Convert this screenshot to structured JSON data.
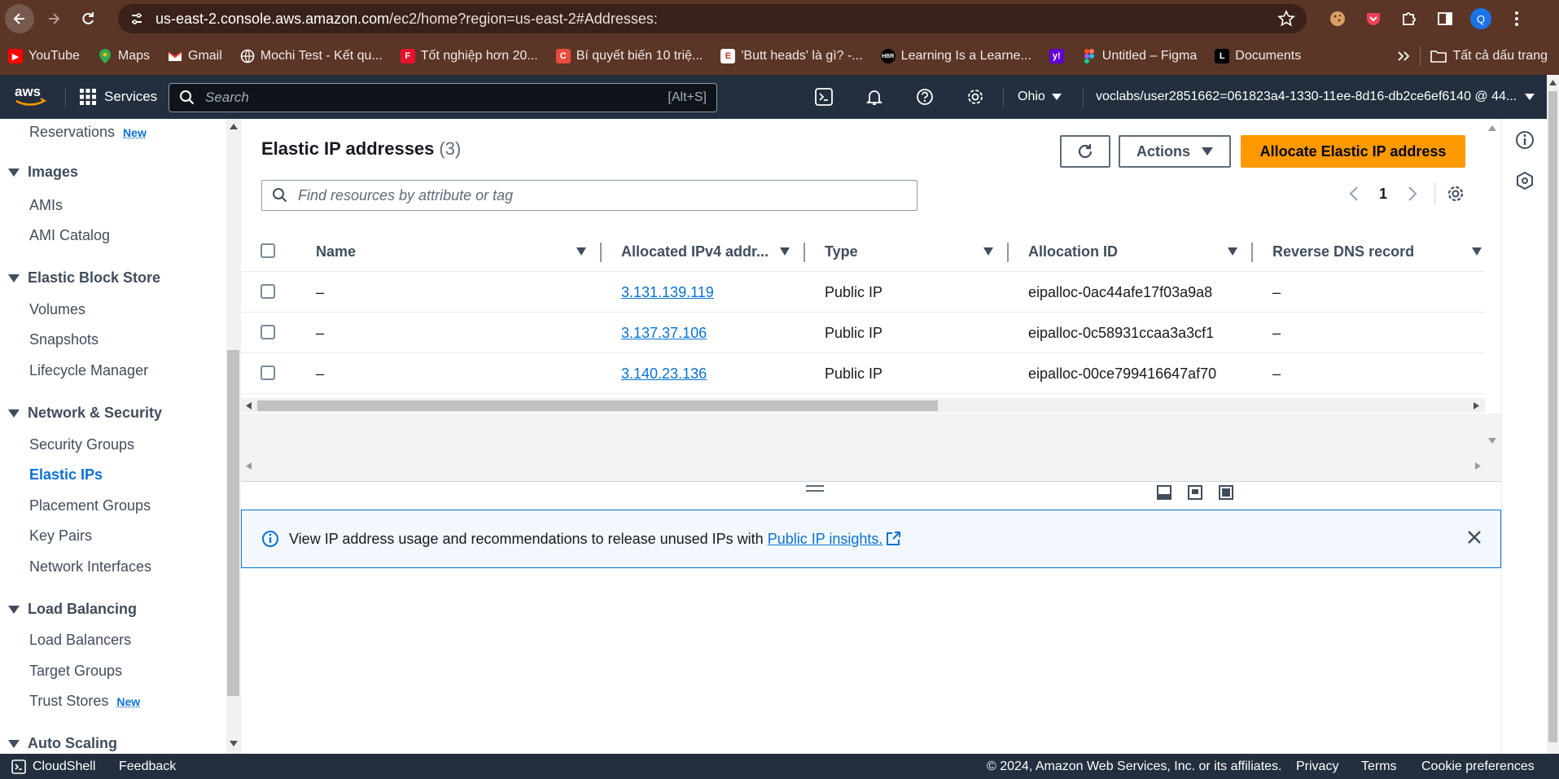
{
  "browser": {
    "url_host": "us-east-2.console.aws.amazon.com",
    "url_path": "/ec2/home?region=us-east-2#Addresses:",
    "bookmarks": [
      "YouTube",
      "Maps",
      "Gmail",
      "Mochi Test - Kết qu...",
      "Tốt nghiệp hơn 20...",
      "Bí quyết biến 10 triệ...",
      "'Butt heads' là gì? -...",
      "Learning Is a Learne...",
      "",
      "Untitled – Figma",
      "Documents"
    ],
    "all_bookmarks": "Tất cả dấu trang",
    "profile_initial": "Q"
  },
  "aws_nav": {
    "services": "Services",
    "search_placeholder": "Search",
    "search_shortcut": "[Alt+S]",
    "region": "Ohio",
    "account": "voclabs/user2851662=061823a4-1330-11ee-8d16-db2ce6ef6140 @ 44..."
  },
  "sidebar": {
    "reservations": "Reservations",
    "new_badge": "New",
    "images": "Images",
    "amis": "AMIs",
    "ami_catalog": "AMI Catalog",
    "ebs": "Elastic Block Store",
    "volumes": "Volumes",
    "snapshots": "Snapshots",
    "lifecycle": "Lifecycle Manager",
    "netsec": "Network & Security",
    "security_groups": "Security Groups",
    "elastic_ips": "Elastic IPs",
    "placement_groups": "Placement Groups",
    "key_pairs": "Key Pairs",
    "network_interfaces": "Network Interfaces",
    "load_balancing": "Load Balancing",
    "load_balancers": "Load Balancers",
    "target_groups": "Target Groups",
    "trust_stores": "Trust Stores",
    "auto_scaling": "Auto Scaling"
  },
  "main": {
    "title": "Elastic IP addresses",
    "count": "(3)",
    "actions": "Actions",
    "allocate": "Allocate Elastic IP address",
    "filter_placeholder": "Find resources by attribute or tag",
    "page": "1",
    "columns": [
      "Name",
      "Allocated IPv4 addr...",
      "Type",
      "Allocation ID",
      "Reverse DNS record"
    ],
    "rows": [
      {
        "name": "–",
        "ip": "3.131.139.119",
        "type": "Public IP",
        "alloc": "eipalloc-0ac44afe17f03a9a8",
        "dns": "–"
      },
      {
        "name": "–",
        "ip": "3.137.37.106",
        "type": "Public IP",
        "alloc": "eipalloc-0c58931ccaa3a3cf1",
        "dns": "–"
      },
      {
        "name": "–",
        "ip": "3.140.23.136",
        "type": "Public IP",
        "alloc": "eipalloc-00ce799416647af70",
        "dns": "–"
      }
    ],
    "notice_text": "View IP address usage and recommendations to release unused IPs with",
    "notice_link": "Public IP insights."
  },
  "footer": {
    "cloudshell": "CloudShell",
    "feedback": "Feedback",
    "copyright": "© 2024, Amazon Web Services, Inc. or its affiliates.",
    "privacy": "Privacy",
    "terms": "Terms",
    "cookies": "Cookie preferences"
  },
  "colors": {
    "aws_nav": "#232f3e",
    "primary_button": "#ff9900",
    "link": "#0972d3",
    "browser_frame": "#5b3526"
  }
}
